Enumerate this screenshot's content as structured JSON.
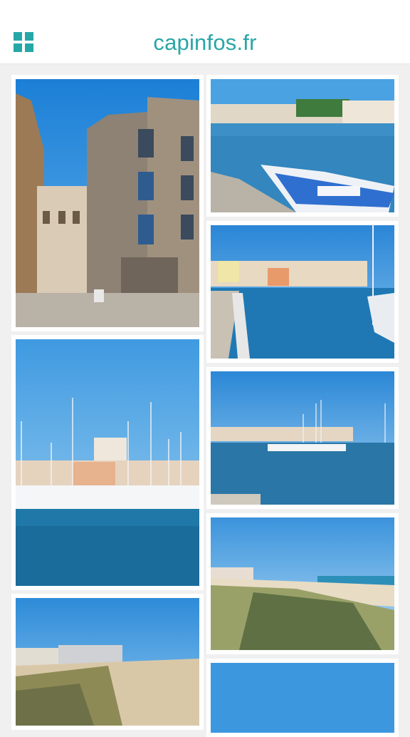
{
  "header": {
    "title": "capinfos.fr",
    "menu_icon": "grid-icon",
    "accent_color": "#2aa6a6"
  },
  "gallery": {
    "photos": [
      {
        "name": "photo-stone-townhouses"
      },
      {
        "name": "photo-harbor-blue-boat"
      },
      {
        "name": "photo-marina-quay"
      },
      {
        "name": "photo-sailboat-harbor"
      },
      {
        "name": "photo-port-view"
      },
      {
        "name": "photo-dunes-sea"
      },
      {
        "name": "photo-beach-residences"
      },
      {
        "name": "photo-sky"
      }
    ]
  }
}
